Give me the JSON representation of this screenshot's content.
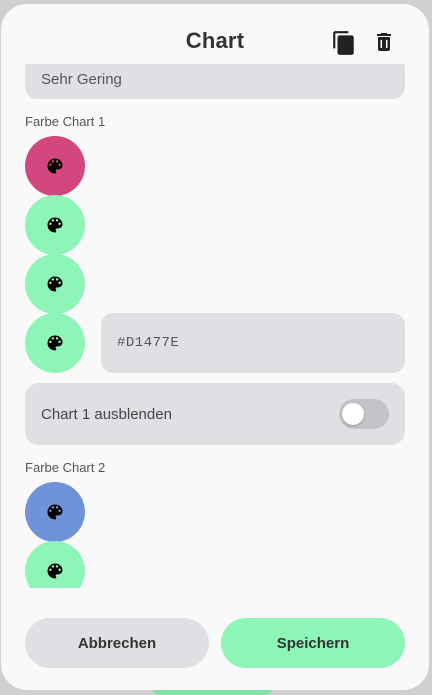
{
  "dialog": {
    "title": "Chart",
    "copy_icon": "copy-icon",
    "delete_icon": "delete-icon"
  },
  "fields": {
    "level_value": "Sehr Gering"
  },
  "chart1": {
    "label": "Farbe Chart 1",
    "swatches": [
      "#D1477E",
      "#8DF5B8",
      "#8DF5B8",
      "#8DF5B8"
    ],
    "hex_value": "#D1477E",
    "hide_label": "Chart 1 ausblenden",
    "hidden": false
  },
  "chart2": {
    "label": "Farbe Chart 2",
    "swatches": [
      "#6F93D8",
      "#8DF5B8"
    ]
  },
  "buttons": {
    "cancel": "Abbrechen",
    "save": "Speichern"
  },
  "colors": {
    "accent_green": "#8DF5B8",
    "surface": "#E0DFE3",
    "background": "#F9F9F9"
  },
  "icons": {
    "swatch_icon": "palette-icon"
  }
}
